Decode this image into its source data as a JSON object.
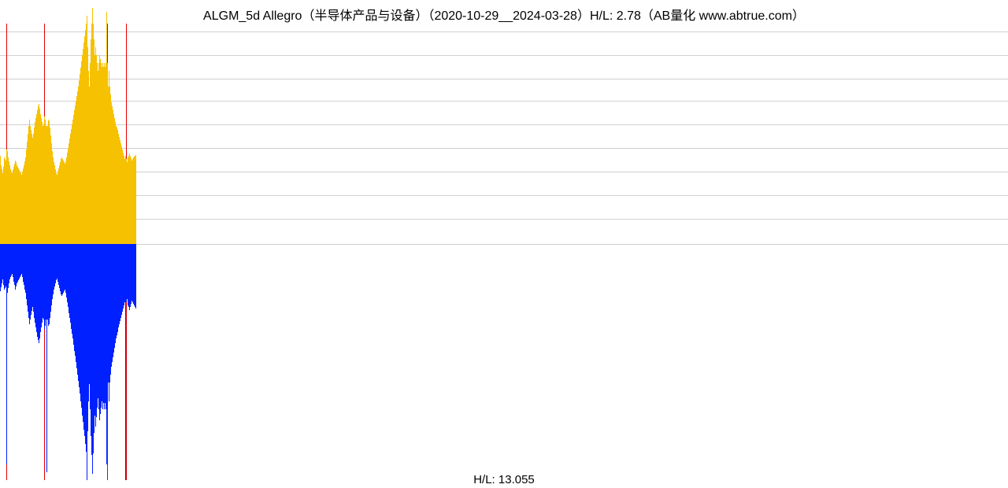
{
  "title": "ALGM_5d Allegro（半导体产品与设备）（2020-10-29__2024-03-28）H/L: 2.78（AB量化  www.abtrue.com）",
  "footer": "H/L: 13.055",
  "chart_data": {
    "type": "bar",
    "title": "ALGM_5d Allegro（半导体产品与设备）（2020-10-29__2024-03-28）H/L: 2.78",
    "xlabel": "",
    "ylabel": "",
    "baseline_y": 310,
    "ylim_top": 8,
    "ylim_bottom": 612,
    "gridlines_y": [
      40,
      70,
      100,
      128,
      158,
      188,
      218,
      248,
      278,
      310
    ],
    "red_vlines_x": [
      8,
      56,
      110,
      136,
      160
    ],
    "series": [
      {
        "name": "upper",
        "color": "#f6c100",
        "x": [
          0,
          1,
          2,
          3,
          4,
          5,
          6,
          7,
          8,
          9,
          10,
          11,
          12,
          13,
          14,
          15,
          16,
          17,
          18,
          19,
          20,
          21,
          22,
          23,
          24,
          25,
          26,
          27,
          28,
          29,
          30,
          31,
          32,
          33,
          34,
          35,
          36,
          37,
          38,
          39,
          40,
          41,
          42,
          43,
          44,
          45,
          46,
          47,
          48,
          49,
          50,
          51,
          52,
          53,
          54,
          55,
          56,
          57,
          58,
          59,
          60,
          61,
          62,
          63,
          64,
          65,
          66,
          67,
          68,
          69,
          70,
          71,
          72,
          73,
          74,
          75,
          76,
          77,
          78,
          79,
          80,
          81,
          82,
          83,
          84,
          85,
          86,
          87,
          88,
          89,
          90,
          91,
          92,
          93,
          94,
          95,
          96,
          97,
          98,
          99,
          100,
          101,
          102,
          103,
          104,
          105,
          106,
          107,
          108,
          109,
          110,
          111,
          112,
          113,
          114,
          115,
          116,
          117,
          118,
          119,
          120,
          121,
          122,
          123,
          124,
          125,
          126,
          127,
          128,
          129,
          130,
          131,
          132,
          133,
          134,
          135,
          136,
          137,
          138,
          139,
          140,
          141,
          142,
          143,
          144,
          145,
          146,
          147,
          148,
          149,
          150,
          151,
          152,
          153,
          154,
          155,
          156,
          157,
          158,
          159,
          160,
          161,
          162,
          163,
          164,
          165,
          166,
          167,
          168,
          169,
          170,
          171,
          172
        ],
        "values": [
          112,
          100,
          95,
          90,
          98,
          110,
          108,
          106,
          120,
          118,
          110,
          105,
          100,
          95,
          92,
          90,
          94,
          98,
          102,
          106,
          104,
          100,
          98,
          96,
          94,
          92,
          90,
          88,
          92,
          96,
          100,
          105,
          110,
          120,
          130,
          140,
          150,
          158,
          150,
          145,
          140,
          135,
          140,
          148,
          155,
          160,
          165,
          170,
          175,
          178,
          172,
          165,
          160,
          155,
          150,
          152,
          162,
          158,
          150,
          150,
          150,
          158,
          156,
          148,
          138,
          128,
          118,
          110,
          104,
          100,
          95,
          90,
          88,
          92,
          96,
          100,
          104,
          108,
          110,
          108,
          106,
          104,
          102,
          105,
          110,
          116,
          122,
          128,
          134,
          140,
          146,
          152,
          158,
          164,
          170,
          176,
          182,
          188,
          194,
          200,
          208,
          216,
          224,
          232,
          240,
          248,
          256,
          264,
          272,
          280,
          290,
          250,
          220,
          200,
          230,
          260,
          280,
          300,
          280,
          260,
          240,
          250,
          240,
          230,
          220,
          230,
          240,
          235,
          230,
          225,
          230,
          225,
          230,
          225,
          230,
          295,
          230,
          200,
          220,
          200,
          190,
          180,
          175,
          170,
          165,
          160,
          155,
          150,
          148,
          145,
          140,
          136,
          132,
          128,
          124,
          120,
          116,
          112,
          108,
          112,
          108,
          104,
          110,
          112,
          115,
          112,
          109,
          106,
          108,
          110,
          111,
          112,
          113
        ]
      },
      {
        "name": "lower",
        "color": "#0020ff",
        "x": [
          0,
          1,
          2,
          3,
          4,
          5,
          6,
          7,
          8,
          9,
          10,
          11,
          12,
          13,
          14,
          15,
          16,
          17,
          18,
          19,
          20,
          21,
          22,
          23,
          24,
          25,
          26,
          27,
          28,
          29,
          30,
          31,
          32,
          33,
          34,
          35,
          36,
          37,
          38,
          39,
          40,
          41,
          42,
          43,
          44,
          45,
          46,
          47,
          48,
          49,
          50,
          51,
          52,
          53,
          54,
          55,
          56,
          57,
          58,
          59,
          60,
          61,
          62,
          63,
          64,
          65,
          66,
          67,
          68,
          69,
          70,
          71,
          72,
          73,
          74,
          75,
          76,
          77,
          78,
          79,
          80,
          81,
          82,
          83,
          84,
          85,
          86,
          87,
          88,
          89,
          90,
          91,
          92,
          93,
          94,
          95,
          96,
          97,
          98,
          99,
          100,
          101,
          102,
          103,
          104,
          105,
          106,
          107,
          108,
          109,
          110,
          111,
          112,
          113,
          114,
          115,
          116,
          117,
          118,
          119,
          120,
          121,
          122,
          123,
          124,
          125,
          126,
          127,
          128,
          129,
          130,
          131,
          132,
          133,
          134,
          135,
          136,
          137,
          138,
          139,
          140,
          141,
          142,
          143,
          144,
          145,
          146,
          147,
          148,
          149,
          150,
          151,
          152,
          153,
          154,
          155,
          156,
          157,
          158,
          159,
          160,
          161,
          162,
          163,
          164,
          165,
          166,
          167,
          168,
          169,
          170,
          171,
          172
        ],
        "values": [
          60,
          55,
          50,
          45,
          52,
          58,
          56,
          54,
          280,
          62,
          56,
          50,
          45,
          42,
          40,
          38,
          42,
          48,
          52,
          58,
          54,
          50,
          48,
          46,
          44,
          42,
          40,
          38,
          42,
          48,
          52,
          58,
          62,
          70,
          78,
          86,
          94,
          102,
          96,
          90,
          85,
          80,
          86,
          94,
          100,
          106,
          112,
          118,
          122,
          126,
          120,
          112,
          106,
          100,
          94,
          96,
          108,
          104,
          96,
          290,
          96,
          104,
          102,
          94,
          86,
          78,
          70,
          64,
          58,
          54,
          50,
          46,
          44,
          48,
          52,
          56,
          60,
          64,
          66,
          64,
          62,
          60,
          58,
          62,
          68,
          74,
          80,
          88,
          94,
          100,
          108,
          114,
          120,
          128,
          136,
          142,
          150,
          158,
          166,
          174,
          182,
          190,
          200,
          208,
          218,
          226,
          236,
          244,
          254,
          264,
          300,
          238,
          200,
          178,
          210,
          244,
          268,
          292,
          266,
          240,
          218,
          232,
          220,
          208,
          196,
          210,
          224,
          216,
          208,
          200,
          210,
          202,
          210,
          202,
          210,
          280,
          210,
          176,
          200,
          176,
          166,
          156,
          150,
          144,
          138,
          132,
          126,
          120,
          116,
          112,
          106,
          102,
          98,
          94,
          90,
          86,
          82,
          78,
          74,
          300,
          74,
          70,
          78,
          80,
          84,
          80,
          76,
          72,
          74,
          76,
          78,
          80,
          82
        ]
      }
    ]
  }
}
